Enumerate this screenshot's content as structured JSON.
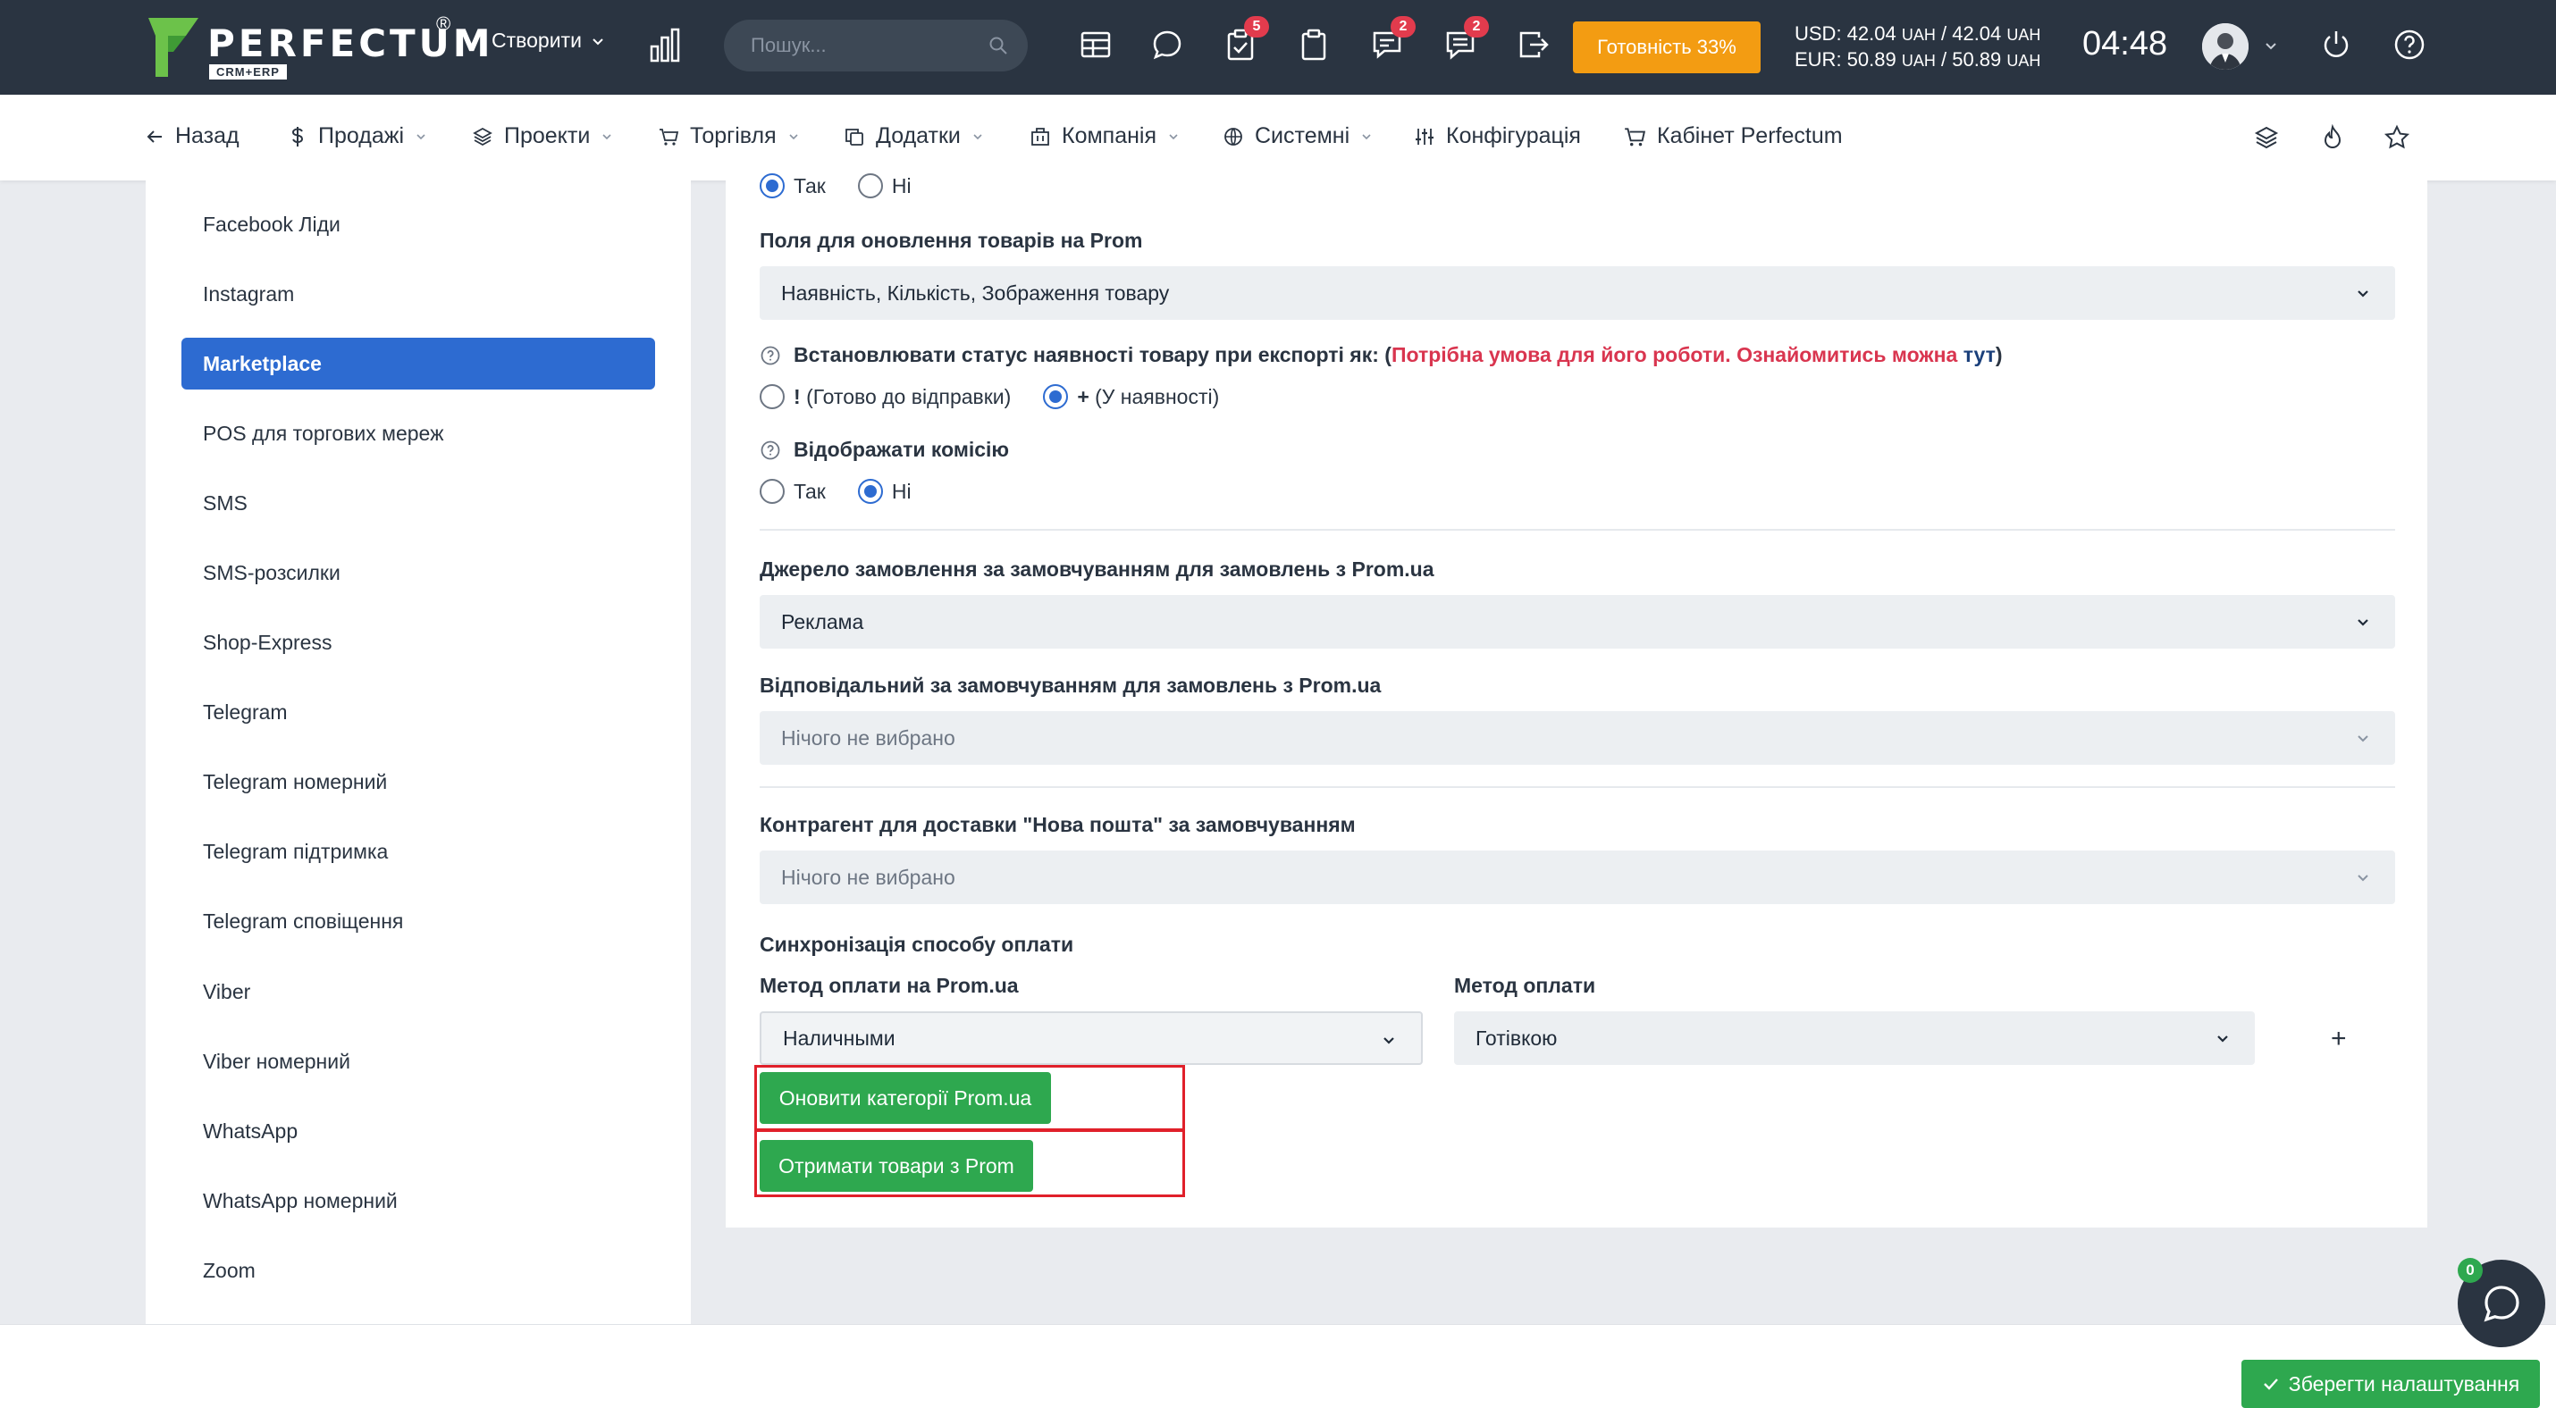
{
  "header": {
    "logo_word": "PERFECTUM",
    "logo_sub": "CRM+ERP",
    "logo_reg": "®",
    "create_label": "Створити",
    "search_placeholder": "Пошук...",
    "badges": {
      "tasks": "5",
      "messages": "2",
      "chat": "2"
    },
    "readiness_label": "Готовність 33%",
    "rates": {
      "usd_prefix": "USD: 42.04",
      "usd_cur1": "UAH",
      "usd_mid": "/ 42.04",
      "usd_cur2": "UAH",
      "eur_prefix": "EUR: 50.89",
      "eur_cur1": "UAH",
      "eur_mid": "/ 50.89",
      "eur_cur2": "UAH"
    },
    "clock": "04:48"
  },
  "nav": {
    "back": "Назад",
    "sales": "Продажі",
    "projects": "Проекти",
    "trade": "Торгівля",
    "addons": "Додатки",
    "company": "Компанія",
    "system": "Системні",
    "config": "Конфігурація",
    "cabinet": "Кабінет Perfectum"
  },
  "sidebar": {
    "items": [
      {
        "label": "Facebook Ліди"
      },
      {
        "label": "Instagram"
      },
      {
        "label": "Marketplace",
        "active": true
      },
      {
        "label": "POS для торгових мереж"
      },
      {
        "label": "SMS"
      },
      {
        "label": "SMS-розсилки"
      },
      {
        "label": "Shop-Express"
      },
      {
        "label": "Telegram"
      },
      {
        "label": "Telegram номерний"
      },
      {
        "label": "Telegram підтримка"
      },
      {
        "label": "Telegram сповіщення"
      },
      {
        "label": "Viber"
      },
      {
        "label": "Viber номерний"
      },
      {
        "label": "WhatsApp"
      },
      {
        "label": "WhatsApp номерний"
      },
      {
        "label": "Zoom"
      }
    ]
  },
  "form": {
    "top_radio": {
      "yes": "Так",
      "no": "Ні",
      "selected": "yes"
    },
    "update_fields_label": "Поля для оновлення товарів на Prom",
    "update_fields_value": "Наявність, Кількість, Зображення товару",
    "status_label": "Встановлювати статус наявності товару при експорті як:",
    "status_open": "(",
    "status_req": "Потрібна умова для його роботи. Ознайомитись можна",
    "status_link": "тут",
    "status_close": ")",
    "status_opt1_sign": "!",
    "status_opt1": "(Готово до відправки)",
    "status_opt2_sign": "+",
    "status_opt2": "(У наявності)",
    "status_selected": "opt2",
    "commission_label": "Відображати комісію",
    "commission_yes": "Так",
    "commission_no": "Ні",
    "commission_selected": "no",
    "source_label": "Джерело замовлення за замовчуванням для замовлень з Prom.ua",
    "source_value": "Реклама",
    "responsible_label": "Відповідальний за замовчуванням для замовлень з Prom.ua",
    "responsible_placeholder": "Нічого не вибрано",
    "contractor_label": "Контрагент для доставки \"Нова пошта\" за замовчуванням",
    "contractor_placeholder": "Нічого не вибрано",
    "payment_sync_label": "Синхронізація способу оплати",
    "prom_method_label": "Метод оплати на Prom.ua",
    "prom_method_value": "Наличными",
    "method_label": "Метод оплати",
    "method_value": "Готівкою",
    "add_symbol": "+",
    "update_categories_btn": "Оновити категорії Prom.ua",
    "get_products_btn": "Отримати товари з Prom"
  },
  "footer": {
    "save_label": "Зберегти налаштування",
    "chat_badge": "0"
  },
  "colors": {
    "topbar": "#2a3441",
    "accent": "#2d6bd1",
    "green": "#2ea84f",
    "orange": "#f39c12",
    "badge_red": "#e23b4d",
    "highlight_red": "#e0202a"
  }
}
